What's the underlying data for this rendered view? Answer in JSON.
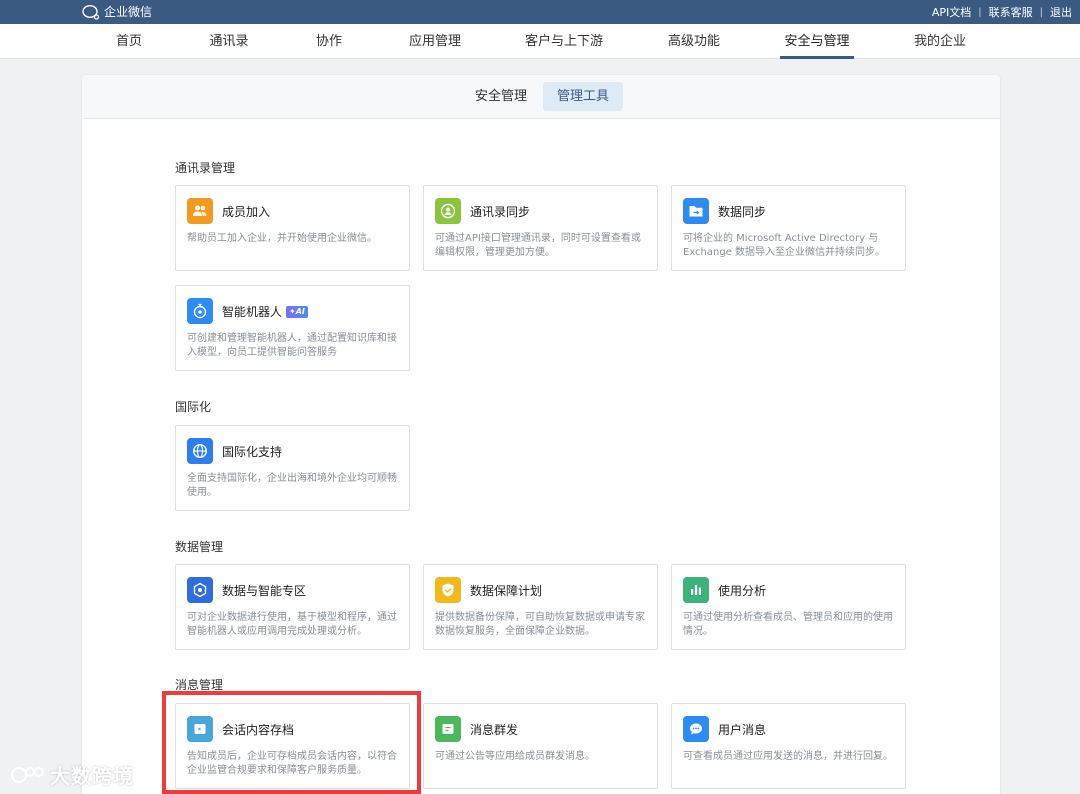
{
  "topbar": {
    "logo_text": "企业微信",
    "links": [
      "API文档",
      "联系客服",
      "退出"
    ],
    "separator": "|"
  },
  "nav": {
    "items": [
      "首页",
      "通讯录",
      "协作",
      "应用管理",
      "客户与上下游",
      "高级功能",
      "安全与管理",
      "我的企业"
    ],
    "active_index": 6
  },
  "subtabs": {
    "items": [
      "安全管理",
      "管理工具"
    ],
    "active_index": 1
  },
  "sections": [
    {
      "title": "通讯录管理",
      "cards": [
        {
          "title": "成员加入",
          "desc": "帮助员工加入企业，并开始使用企业微信。",
          "icon": "people-icon",
          "color": "#f39a20"
        },
        {
          "title": "通讯录同步",
          "desc": "可通过API接口管理通讯录，同时可设置查看或编辑权限，管理更加方便。",
          "icon": "contact-sync-icon",
          "color": "#8cc43f"
        },
        {
          "title": "数据同步",
          "desc": "可将企业的 Microsoft Active Directory 与 Exchange 数据导入至企业微信并持续同步。",
          "icon": "folder-sync-icon",
          "color": "#2e8cf0"
        },
        {
          "title": "智能机器人",
          "badge": "AI",
          "desc": "可创建和管理智能机器人，通过配置知识库和接入模型，向员工提供智能问答服务",
          "icon": "robot-icon",
          "color": "#2e8cf0"
        }
      ]
    },
    {
      "title": "国际化",
      "cards": [
        {
          "title": "国际化支持",
          "desc": "全面支持国际化，企业出海和境外企业均可顺畅使用。",
          "icon": "globe-icon",
          "color": "#2e7ef0"
        }
      ]
    },
    {
      "title": "数据管理",
      "cards": [
        {
          "title": "数据与智能专区",
          "desc": "可对企业数据进行使用，基于模型和程序，通过智能机器人或应用调用完成处理或分析。",
          "icon": "data-zone-icon",
          "color": "#2e6ce0"
        },
        {
          "title": "数据保障计划",
          "desc": "提供数据备份保障，可自助恢复数据或申请专家数据恢复服务，全面保障企业数据。",
          "icon": "shield-icon",
          "color": "#f2b81c"
        },
        {
          "title": "使用分析",
          "desc": "可通过使用分析查看成员、管理员和应用的使用情况。",
          "icon": "bar-chart-icon",
          "color": "#3bb37a"
        }
      ]
    },
    {
      "title": "消息管理",
      "cards": [
        {
          "title": "会话内容存档",
          "desc": "告知成员后，企业可存档成员会话内容，以符合企业监管合规要求和保障客户服务质量。",
          "icon": "archive-icon",
          "color": "#4aa6d9"
        },
        {
          "title": "消息群发",
          "desc": "可通过公告等应用给成员群发消息。",
          "icon": "broadcast-icon",
          "color": "#4cb85b"
        },
        {
          "title": "用户消息",
          "desc": "可查看成员通过应用发送的消息，并进行回复。",
          "icon": "chat-bubble-icon",
          "color": "#2e8cf0"
        }
      ]
    }
  ],
  "watermark": "大数跨境"
}
